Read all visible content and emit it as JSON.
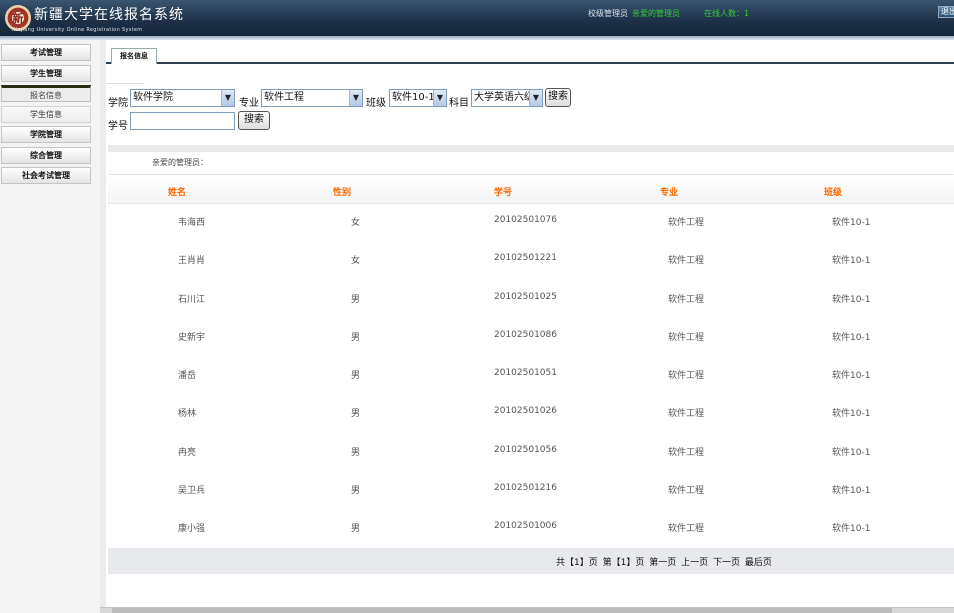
{
  "header": {
    "title_cn": "新疆大学在线报名系统",
    "title_en": "Xinjiang University Online Registration System",
    "logo_glyph": "新",
    "user_label": "校级管理员",
    "user_value": "亲爱的管理员",
    "online_text": "在线人数：1",
    "exit_label": "退出"
  },
  "sidebar": {
    "items": [
      {
        "label": "考试管理"
      },
      {
        "label": "学生管理"
      },
      {
        "label": "报名信息"
      },
      {
        "label": "学生信息"
      },
      {
        "label": "学院管理"
      },
      {
        "label": "综合管理"
      },
      {
        "label": "社会考试管理"
      }
    ]
  },
  "tab": {
    "label": "报名信息"
  },
  "filters": {
    "college_label": "学院",
    "college_value": "软件学院",
    "major_label": "专业",
    "major_value": "软件工程",
    "class_label": "班级",
    "class_value": "软件10-1",
    "subject_label": "科目",
    "subject_value": "大学英语六级",
    "search_label": "搜索",
    "student_id_label": "学号",
    "student_id_value": "",
    "search2_label": "搜索"
  },
  "greeting": "亲爱的管理员：",
  "table": {
    "headers": [
      "姓名",
      "性别",
      "学号",
      "专业",
      "班级"
    ],
    "rows": [
      [
        "韦海西",
        "女",
        "20102501076",
        "软件工程",
        "软件10-1"
      ],
      [
        "王肖肖",
        "女",
        "20102501221",
        "软件工程",
        "软件10-1"
      ],
      [
        "石川江",
        "男",
        "20102501025",
        "软件工程",
        "软件10-1"
      ],
      [
        "史新宇",
        "男",
        "20102501086",
        "软件工程",
        "软件10-1"
      ],
      [
        "潘岳",
        "男",
        "20102501051",
        "软件工程",
        "软件10-1"
      ],
      [
        "杨林",
        "男",
        "20102501026",
        "软件工程",
        "软件10-1"
      ],
      [
        "冉亮",
        "男",
        "20102501056",
        "软件工程",
        "软件10-1"
      ],
      [
        "吴卫兵",
        "男",
        "20102501216",
        "软件工程",
        "软件10-1"
      ],
      [
        "康小强",
        "男",
        "20102501006",
        "软件工程",
        "软件10-1"
      ]
    ]
  },
  "pager": {
    "total_pages": "共【1】页",
    "current_page": "第【1】页",
    "first": "第一页",
    "prev": "上一页",
    "next": "下一页",
    "last": "最后页"
  },
  "colors": {
    "header_bg": "#1c3046",
    "header_accent": "#33cc33",
    "column_header": "#ff6600",
    "tabbar_line": "#2c3e52"
  }
}
